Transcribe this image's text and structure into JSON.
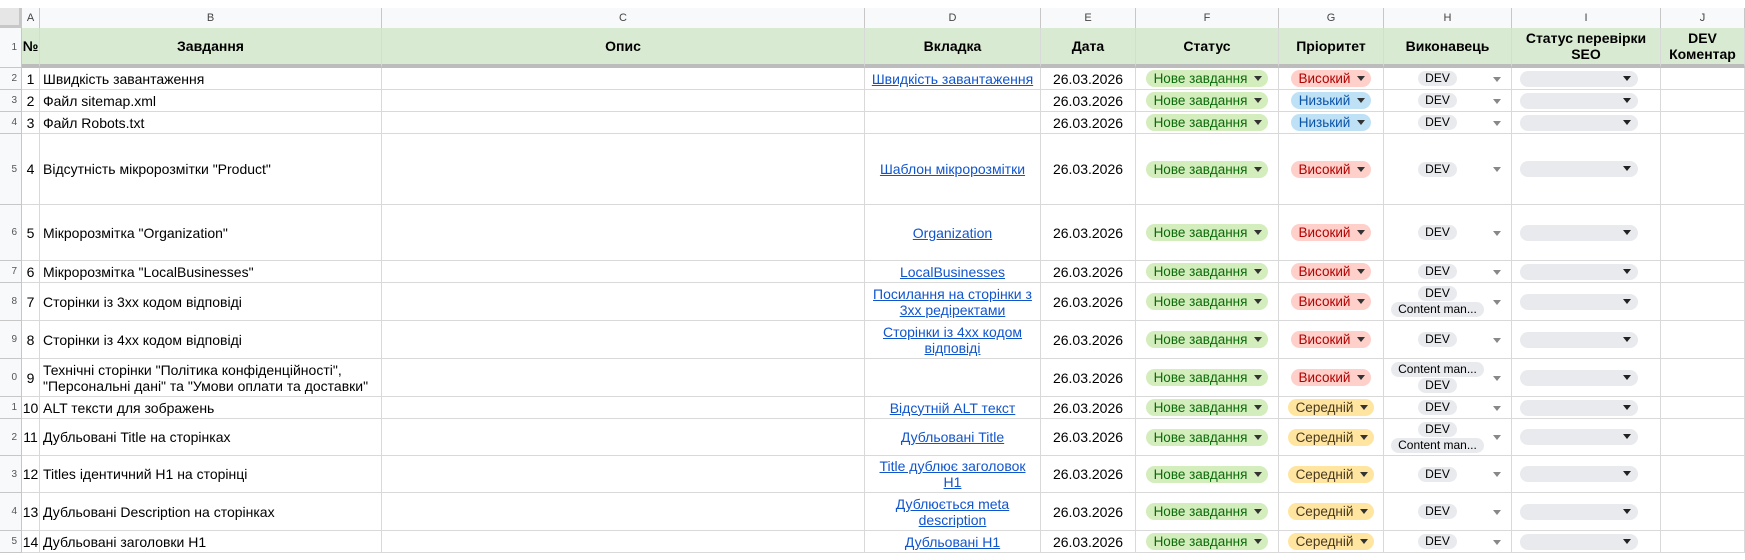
{
  "column_letters": [
    "A",
    "B",
    "C",
    "D",
    "E",
    "F",
    "G",
    "H",
    "I",
    "J"
  ],
  "row_numbers": [
    "1",
    "2",
    "3",
    "4",
    "5",
    "6",
    "7",
    "8",
    "9",
    "0",
    "1",
    "2",
    "3",
    "4",
    "5"
  ],
  "headers": {
    "num": "№",
    "task": "Завдання",
    "desc": "Опис",
    "tab": "Вкладка",
    "date": "Дата",
    "status": "Статус",
    "priority": "Пріоритет",
    "assignee": "Виконавець",
    "seo": "Статус перевірки SEO",
    "dev_comment": "DEV Коментар"
  },
  "colors": {
    "header_bg": "#d9ead3",
    "status_chip": "#d4edbc",
    "priority_high": "#ffcfc9",
    "priority_low": "#bfe1f6",
    "priority_mid": "#ffe5a0",
    "link": "#1155cc"
  },
  "rows": [
    {
      "num": "1",
      "task": "Швидкість завантаження",
      "tab": "Швидкість завантаження",
      "date": "26.03.2026",
      "status": "Нове завдання",
      "priority": "Високий",
      "prio": "high",
      "assignees": [
        "DEV"
      ]
    },
    {
      "num": "2",
      "task": "Файл sitemap.xml",
      "tab": "",
      "date": "26.03.2026",
      "status": "Нове завдання",
      "priority": "Низький",
      "prio": "low",
      "assignees": [
        "DEV"
      ]
    },
    {
      "num": "3",
      "task": "Файл Robots.txt",
      "tab": "",
      "date": "26.03.2026",
      "status": "Нове завдання",
      "priority": "Низький",
      "prio": "low",
      "assignees": [
        "DEV"
      ]
    },
    {
      "num": "4",
      "task": "Відсутність мікророзмітки \"Product\"",
      "tab": "Шаблон мікророзмітки",
      "date": "26.03.2026",
      "status": "Нове завдання",
      "priority": "Високий",
      "prio": "high",
      "assignees": [
        "DEV"
      ]
    },
    {
      "num": "5",
      "task": "Мікророзмітка \"Organization\"",
      "tab": "Organization",
      "date": "26.03.2026",
      "status": "Нове завдання",
      "priority": "Високий",
      "prio": "high",
      "assignees": [
        "DEV"
      ]
    },
    {
      "num": "6",
      "task": "Мікророзмітка \"LocalBusinesses\"",
      "tab": "LocalBusinesses",
      "date": "26.03.2026",
      "status": "Нове завдання",
      "priority": "Високий",
      "prio": "high",
      "assignees": [
        "DEV"
      ]
    },
    {
      "num": "7",
      "task": "Сторінки із 3хх кодом відповіді",
      "tab": "Посилання на сторінки з 3хх редіректами",
      "date": "26.03.2026",
      "status": "Нове завдання",
      "priority": "Високий",
      "prio": "high",
      "assignees": [
        "DEV",
        "Content man..."
      ]
    },
    {
      "num": "8",
      "task": "Сторінки із 4хх кодом відповіді",
      "tab": "Сторінки із 4хх кодом відповіді",
      "date": "26.03.2026",
      "status": "Нове завдання",
      "priority": "Високий",
      "prio": "high",
      "assignees": [
        "DEV"
      ]
    },
    {
      "num": "9",
      "task": "Технічні сторінки \"Політика конфіденційності\", \"Персональні дані\" та \"Умови оплати та доставки\"",
      "tab": "",
      "date": "26.03.2026",
      "status": "Нове завдання",
      "priority": "Високий",
      "prio": "high",
      "assignees": [
        "Content man...",
        "DEV"
      ]
    },
    {
      "num": "10",
      "task": "ALT тексти для зображень",
      "tab": "Відсутній ALT текст",
      "date": "26.03.2026",
      "status": "Нове завдання",
      "priority": "Середній",
      "prio": "mid",
      "assignees": [
        "DEV"
      ]
    },
    {
      "num": "11",
      "task": "Дубльовані Title на сторінках",
      "tab": "Дубльовані Title",
      "date": "26.03.2026",
      "status": "Нове завдання",
      "priority": "Середній",
      "prio": "mid",
      "assignees": [
        "DEV",
        "Content man..."
      ]
    },
    {
      "num": "12",
      "task": "Titles ідентичний Н1 на сторінці",
      "tab": "Title дублює заголовок H1",
      "date": "26.03.2026",
      "status": "Нове завдання",
      "priority": "Середній",
      "prio": "mid",
      "assignees": [
        "DEV"
      ]
    },
    {
      "num": "13",
      "task": "Дубльовані Description на сторінках",
      "tab": "Дублюється meta description",
      "date": "26.03.2026",
      "status": "Нове завдання",
      "priority": "Середній",
      "prio": "mid",
      "assignees": [
        "DEV"
      ]
    },
    {
      "num": "14",
      "task": "Дубльовані заголовки Н1",
      "tab": "Дубльовані H1",
      "date": "26.03.2026",
      "status": "Нове завдання",
      "priority": "Середній",
      "prio": "mid",
      "assignees": [
        "DEV"
      ]
    }
  ]
}
